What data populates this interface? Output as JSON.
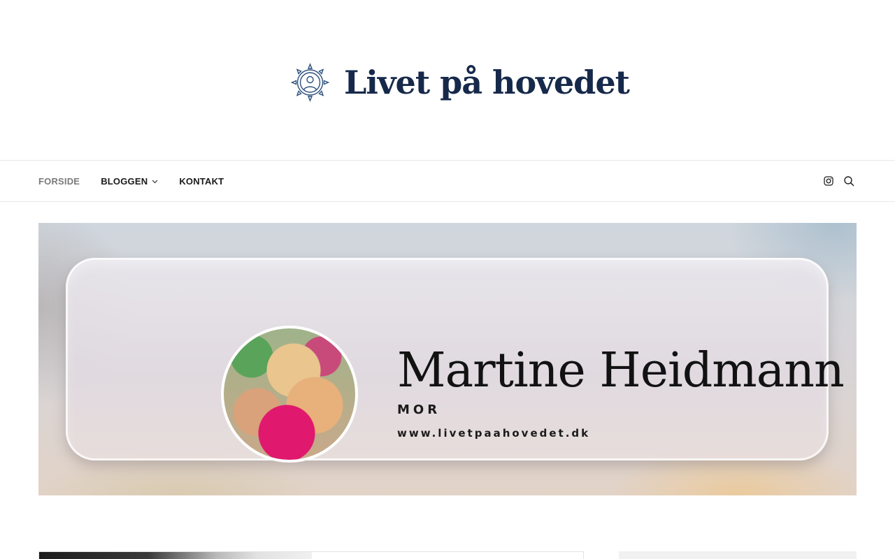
{
  "site": {
    "title": "Livet på hovedet",
    "logo_icon": "compass-person-icon",
    "brand_color": "#16294a"
  },
  "nav": {
    "items": [
      {
        "label": "FORSIDE",
        "active": true
      },
      {
        "label": "BLOGGEN",
        "has_dropdown": true
      },
      {
        "label": "KONTAKT"
      }
    ],
    "tools": [
      {
        "icon": "instagram-icon"
      },
      {
        "icon": "search-icon"
      }
    ]
  },
  "hero": {
    "name": "Martine Heidmann",
    "role": "MOR",
    "url": "www.livetpaahovedet.dk"
  }
}
